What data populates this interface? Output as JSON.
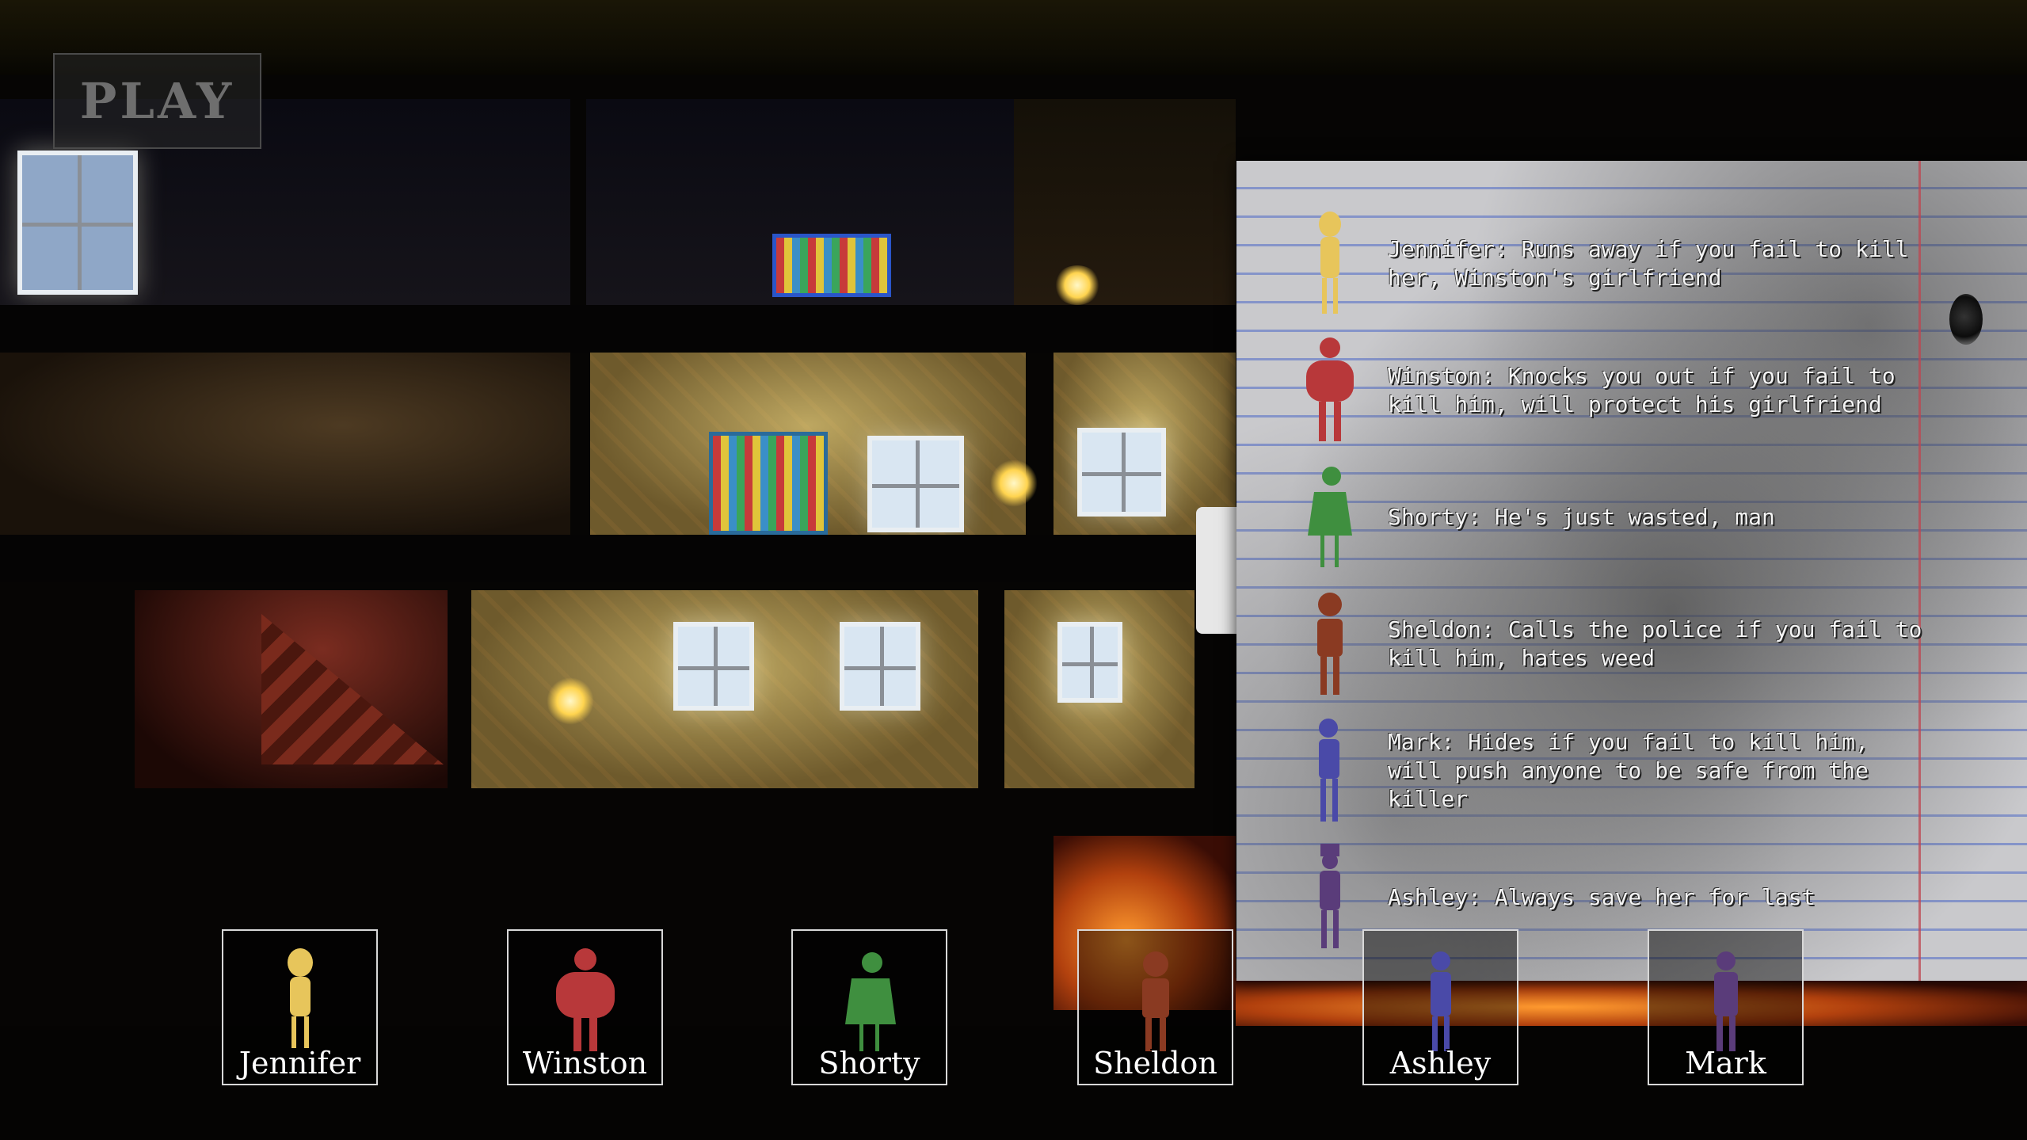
{
  "menu": {
    "play_label": "PLAY"
  },
  "notes": {
    "entries": [
      {
        "name": "Jennifer",
        "text": "Jennifer: Runs away if you fail to kill her, Winston's girlfriend",
        "color": "#e7c55b"
      },
      {
        "name": "Winston",
        "text": "Winston: Knocks you out if you fail to kill him, will protect his girlfriend",
        "color": "#b8383a"
      },
      {
        "name": "Shorty",
        "text": "Shorty: He's just wasted, man",
        "color": "#3f8f3f"
      },
      {
        "name": "Sheldon",
        "text": "Sheldon: Calls the police if you fail to kill him, hates weed",
        "color": "#8a3a22"
      },
      {
        "name": "Mark",
        "text": "Mark: Hides if you fail to kill him, will push anyone to be safe from the killer",
        "color": "#4a4aa8"
      },
      {
        "name": "Ashley",
        "text": "Ashley: Always save her for last",
        "color": "#5a3c7a"
      }
    ]
  },
  "characters": [
    {
      "name": "Jennifer",
      "color": "#e7c55b"
    },
    {
      "name": "Winston",
      "color": "#b8383a"
    },
    {
      "name": "Shorty",
      "color": "#3f8f3f"
    },
    {
      "name": "Sheldon",
      "color": "#8a3a22"
    },
    {
      "name": "Ashley",
      "color": "#4a4aa8"
    },
    {
      "name": "Mark",
      "color": "#5a3c7a"
    }
  ]
}
